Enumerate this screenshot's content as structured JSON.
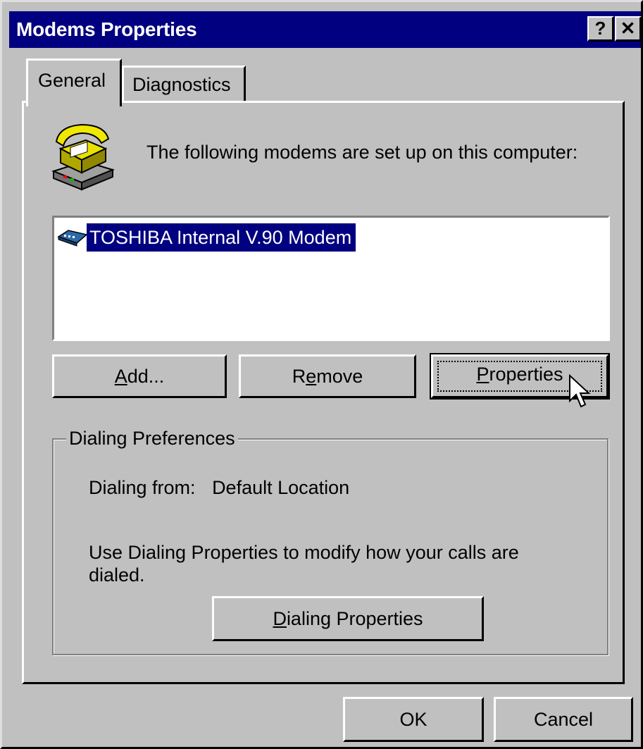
{
  "window": {
    "title": "Modems Properties"
  },
  "caption_buttons": {
    "help": "?",
    "close": "✕"
  },
  "tabs": [
    {
      "label": "General",
      "selected": true
    },
    {
      "label": "Diagnostics",
      "selected": false
    }
  ],
  "general": {
    "intro_text": "The following modems are set up on this computer:",
    "modems": [
      {
        "name": "TOSHIBA Internal V.90 Modem",
        "selected": true,
        "icon": "modem-icon"
      }
    ],
    "buttons": {
      "add": {
        "pre": "",
        "mnemonic": "A",
        "post": "dd..."
      },
      "remove": {
        "pre": "R",
        "mnemonic": "e",
        "post": "move"
      },
      "properties": {
        "pre": "",
        "mnemonic": "P",
        "post": "roperties"
      }
    },
    "dialing_preferences": {
      "title": "Dialing Preferences",
      "dialing_from_label": "Dialing from:",
      "dialing_from_value": "Default Location",
      "description": "Use Dialing Properties to modify how your calls are dialed.",
      "button": {
        "pre": "",
        "mnemonic": "D",
        "post": "ialing Properties"
      }
    }
  },
  "dialog_buttons": {
    "ok": "OK",
    "cancel": "Cancel"
  },
  "colors": {
    "face": "#c0c0c0",
    "titlebar": "#000080",
    "selection": "#000080"
  }
}
